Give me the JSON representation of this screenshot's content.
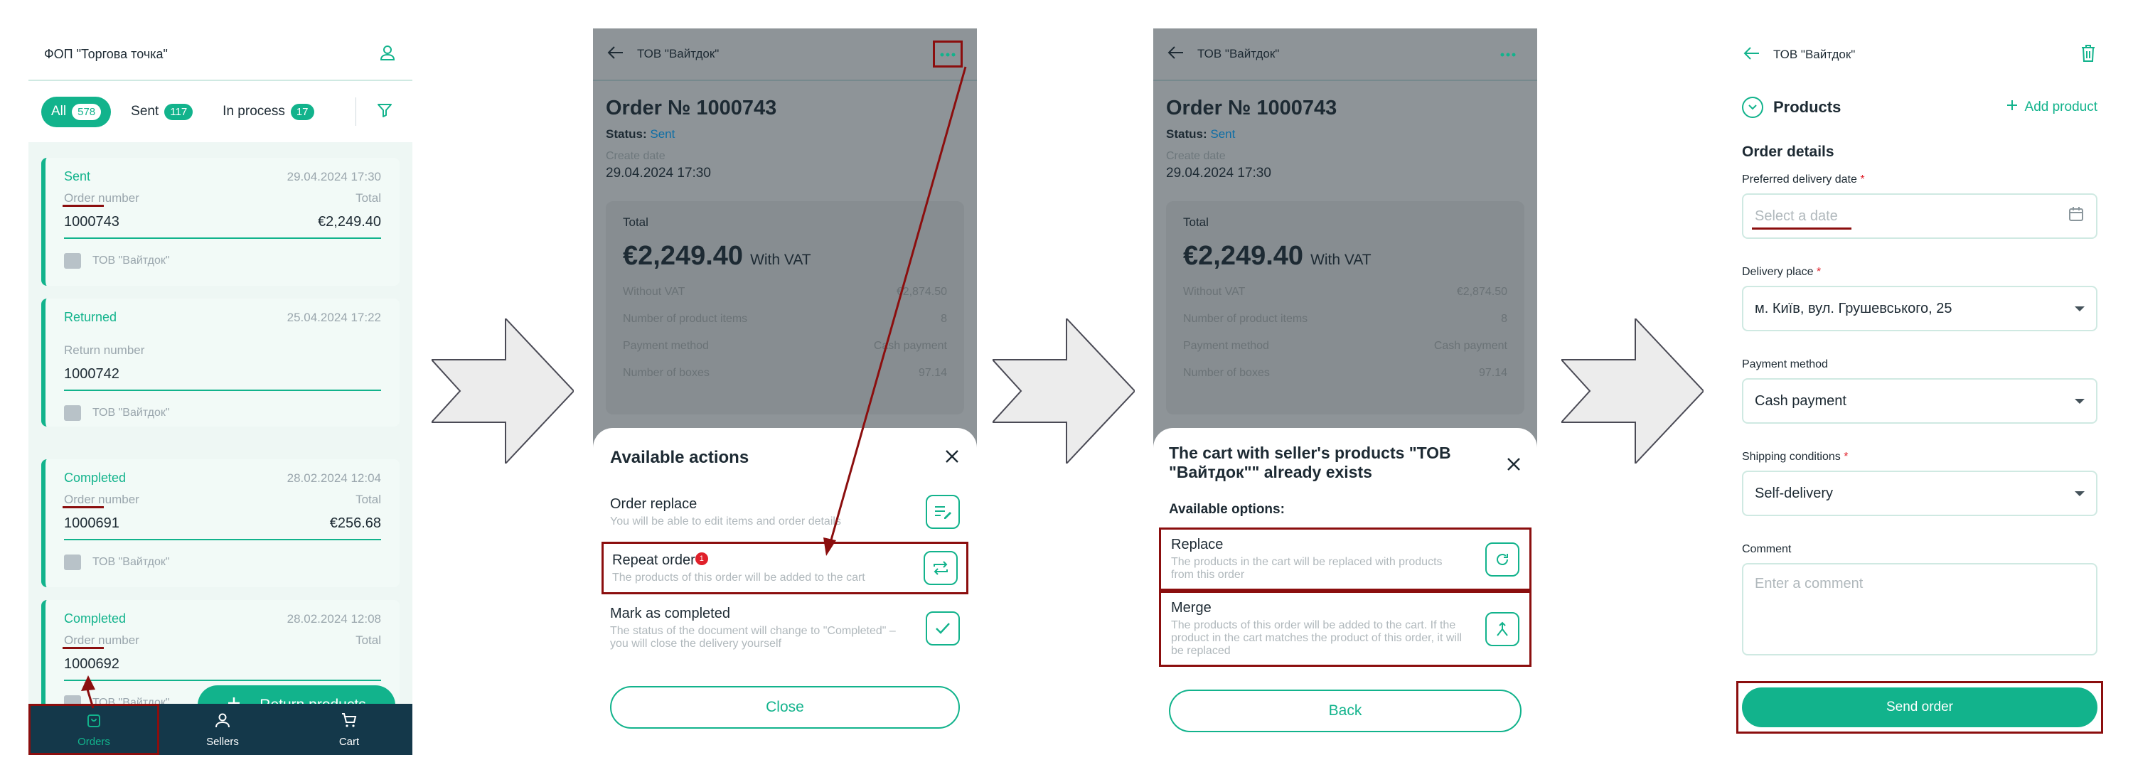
{
  "screen1": {
    "company": "ФОП \"Торгова точка\"",
    "filters": [
      {
        "label": "All",
        "count": "578"
      },
      {
        "label": "Sent",
        "count": "117"
      },
      {
        "label": "In process",
        "count": "17"
      }
    ],
    "cards": [
      {
        "status": "Sent",
        "date": "29.04.2024 17:30",
        "number_label": "Order number",
        "total_label": "Total",
        "number": "1000743",
        "total": "€2,249.40",
        "seller": "ТОВ \"Вайтдок\""
      },
      {
        "status": "Returned",
        "date": "25.04.2024 17:22",
        "number_label": "Return number",
        "total_label": "",
        "number": "1000742",
        "total": "",
        "seller": "ТОВ \"Вайтдок\""
      },
      {
        "status": "Completed",
        "date": "28.02.2024 12:04",
        "number_label": "Order number",
        "total_label": "Total",
        "number": "1000691",
        "total": "€256.68",
        "seller": "ТОВ \"Вайтдок\""
      },
      {
        "status": "Completed",
        "date": "28.02.2024 12:08",
        "number_label": "Order number",
        "total_label": "Total",
        "number": "1000692",
        "total": "",
        "seller": "ТОВ \"Вайтдок\""
      }
    ],
    "return_button": "Return products",
    "nav": [
      {
        "label": "Orders",
        "icon": "bag-icon"
      },
      {
        "label": "Sellers",
        "icon": "person-icon"
      },
      {
        "label": "Cart",
        "icon": "cart-icon"
      }
    ]
  },
  "order": {
    "seller": "ТОВ \"Вайтдок\"",
    "title": "Order № 1000743",
    "status_label": "Status:",
    "status": "Sent",
    "create_label": "Create date",
    "create_date": "29.04.2024 17:30",
    "total_label": "Total",
    "total": "€2,249.40",
    "vat": "With VAT",
    "rows": [
      {
        "k": "Without VAT",
        "v": "€2,874.50"
      },
      {
        "k": "Number of product items",
        "v": "8"
      },
      {
        "k": "Payment method",
        "v": "Cash payment"
      },
      {
        "k": "Number of boxes",
        "v": "97.14"
      }
    ],
    "products_label": "Products"
  },
  "screen2": {
    "sheet_title": "Available actions",
    "actions": [
      {
        "name": "Order replace",
        "desc": "You will be able to edit items and order details",
        "icon": "edit-list-icon"
      },
      {
        "name": "Repeat order",
        "desc": "The products of this order will be added to the cart",
        "icon": "repeat-icon",
        "notif": "1"
      },
      {
        "name": "Mark as completed",
        "desc": "The status of the document will change to \"Completed\" – you will close the delivery yourself",
        "icon": "check-icon"
      }
    ],
    "close_button": "Close"
  },
  "screen3": {
    "sheet_title": "The cart with seller's products \"ТОВ \"Вайтдок\"\" already exists",
    "options_label": "Available options:",
    "options": [
      {
        "name": "Replace",
        "desc": "The products in the cart will be replaced with products from this order",
        "icon": "refresh-icon"
      },
      {
        "name": "Merge",
        "desc": "The products of this order will be added to the cart. If the product in the cart matches the product of this order, it will be replaced",
        "icon": "merge-icon"
      }
    ],
    "back_button": "Back"
  },
  "screen4": {
    "seller": "ТОВ \"Вайтдок\"",
    "products_label": "Products",
    "add_product": "Add product",
    "details_title": "Order details",
    "delivery_date_label": "Preferred delivery date",
    "delivery_date_placeholder": "Select a date",
    "delivery_place_label": "Delivery place",
    "delivery_place": "м. Київ, вул. Грушевського, 25",
    "payment_label": "Payment method",
    "payment": "Cash payment",
    "shipping_label": "Shipping conditions",
    "shipping": "Self-delivery",
    "comment_label": "Comment",
    "comment_placeholder": "Enter a comment",
    "send_button": "Send order"
  },
  "colors": {
    "accent": "#12b38c",
    "dark": "#14384a",
    "marker": "#8b0e0e",
    "link": "#0e6ea5"
  }
}
